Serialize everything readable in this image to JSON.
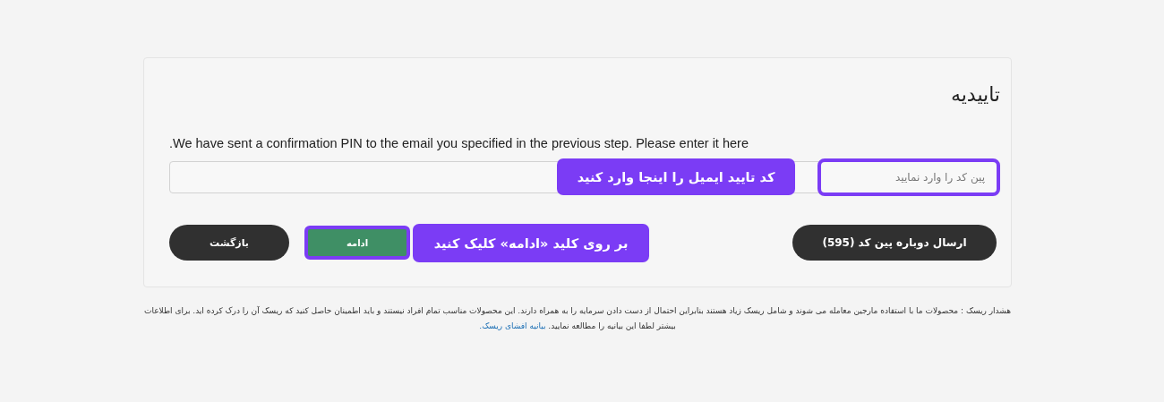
{
  "title": "تاییدیه",
  "message": ".We have sent a confirmation PIN to the email you specified in the previous step. Please enter it here",
  "pin_field": {
    "placeholder": "پین کد را وارد نمایید",
    "highlighted": true
  },
  "annotations": [
    {
      "kind": "field",
      "text": "کد تایید ایمیل را اینجا وارد کنید"
    },
    {
      "kind": "button",
      "text": "بر روی کلید «ادامه» کلیک کنید"
    }
  ],
  "buttons": [
    {
      "kind": "resend",
      "label": "ارسال دوباره پین کد (595)"
    },
    {
      "kind": "continue",
      "label": "ادامه",
      "highlighted": true
    },
    {
      "kind": "back",
      "label": "بازگشت"
    }
  ],
  "risk_notice": {
    "text": "هشدار ریسک : محصولات ما با استفاده مارجین معامله می شوند و شامل ریسک زیاد هستند بنابراین احتمال از دست دادن سرمایه را به همراه دارند. این محصولات مناسب تمام افراد نیستند و باید اطمینان حاصل کنید که ریسک آن را درک کرده اید. برای اطلاعات بیشتر لطفا این بیانیه را مطالعه نمایید.",
    "link": "بیانیه افشای ریسک."
  }
}
